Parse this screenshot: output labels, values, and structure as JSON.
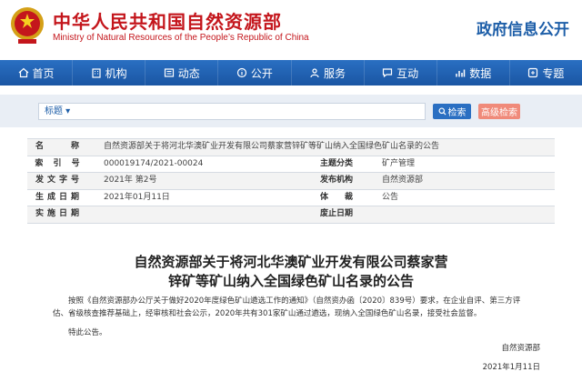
{
  "header": {
    "title_cn": "中华人民共和国自然资源部",
    "title_en": "Ministry of Natural Resources of the People’s Republic of China",
    "right_title": "政府信息公开"
  },
  "nav": {
    "items": [
      {
        "label": "首页",
        "icon": "home-icon"
      },
      {
        "label": "机构",
        "icon": "building-icon"
      },
      {
        "label": "动态",
        "icon": "news-icon"
      },
      {
        "label": "公开",
        "icon": "info-icon"
      },
      {
        "label": "服务",
        "icon": "service-icon"
      },
      {
        "label": "互动",
        "icon": "chat-icon"
      },
      {
        "label": "数据",
        "icon": "chart-icon"
      },
      {
        "label": "专题",
        "icon": "topic-icon"
      }
    ]
  },
  "search": {
    "select_label": "标题 ▾",
    "placeholder": "",
    "search_button": "检索",
    "advanced_button": "高级检索"
  },
  "meta": {
    "name_key": "名　　称",
    "name_value": "自然资源部关于将河北华澳矿业开发有限公司蔡家营锌矿等矿山纳入全国绿色矿山名录的公告",
    "index_key": "索 引 号",
    "index_value": "000019174/2021-00024",
    "category_key": "主题分类",
    "category_value": "矿产管理",
    "doc_key": "发文字号",
    "doc_value": "2021年 第2号",
    "org_key": "发布机构",
    "org_value": "自然资源部",
    "gen_key": "生成日期",
    "gen_value": "2021年01月11日",
    "genre_key": "体　　裁",
    "genre_value": "公告",
    "impl_key": "实施日期",
    "impl_value": "",
    "expire_key": "废止日期",
    "expire_value": ""
  },
  "article": {
    "title_line1": "自然资源部关于将河北华澳矿业开发有限公司蔡家营",
    "title_line2": "锌矿等矿山纳入全国绿色矿山名录的公告",
    "body": "按照《自然资源部办公厅关于做好2020年度绿色矿山遴选工作的通知》（自然资办函〔2020〕839号）要求，在企业自评、第三方评估、省级核查推荐基础上，经审核和社会公示，2020年共有301家矿山通过遴选，现纳入全国绿色矿山名录，接受社会监督。",
    "closing": "特此公告。",
    "signature": "自然资源部",
    "date": "2021年1月11日"
  },
  "colors": {
    "brand_red": "#c4161c",
    "nav_blue": "#1a56a3",
    "search_btn": "#2a6fc2",
    "advanced_btn": "#f08a7a"
  }
}
